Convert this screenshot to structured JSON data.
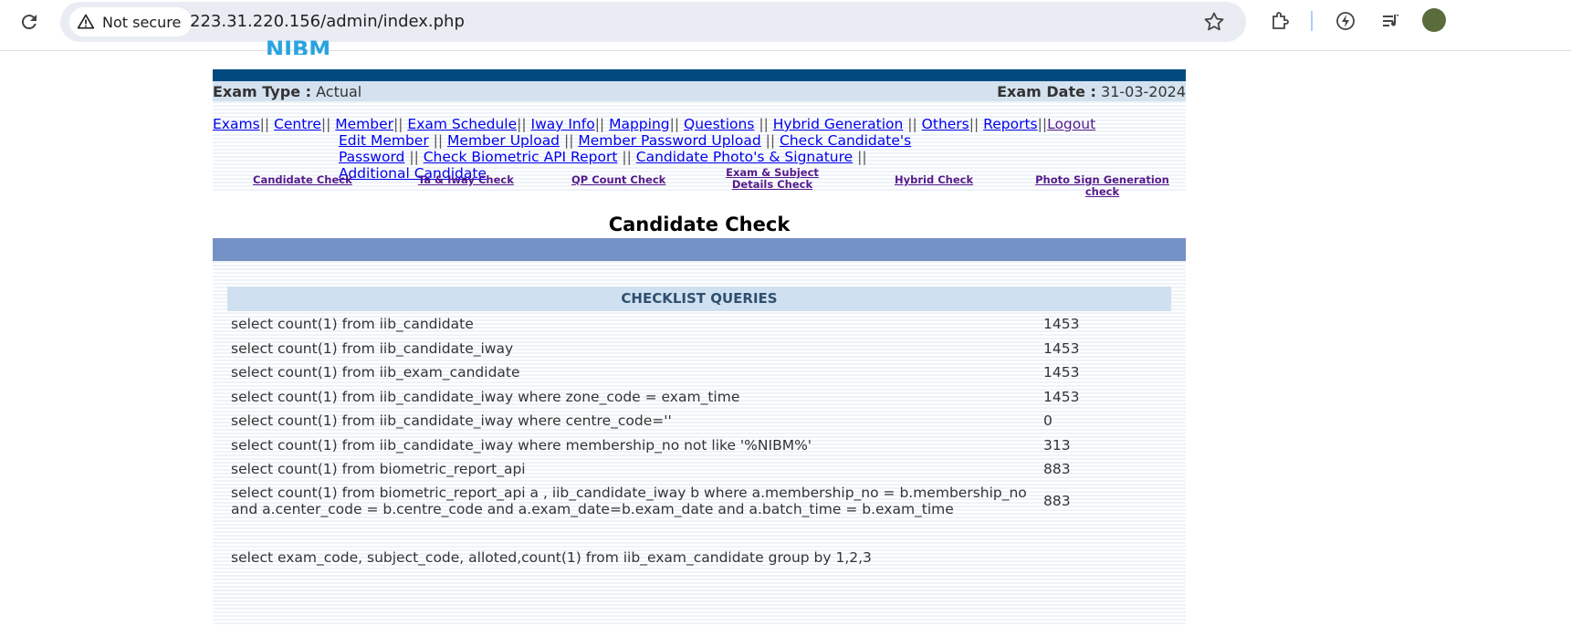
{
  "browser": {
    "security_label": "Not secure",
    "url": "223.31.220.156/admin/index.php"
  },
  "header": {
    "exam_type_label": "Exam Type :",
    "exam_type_value": "Actual",
    "exam_date_label": "Exam Date :",
    "exam_date_value": "31-03-2024"
  },
  "nav": {
    "items": [
      "Exams",
      "Centre",
      "Member",
      "Exam Schedule",
      "Iway Info",
      "Mapping",
      "Questions",
      "Hybrid Generation",
      "Others",
      "Reports",
      "Logout"
    ],
    "sep": "||"
  },
  "submenu": {
    "items": [
      "Edit Member",
      "Member Upload",
      "Member Password Upload",
      "Check Candidate's Password",
      "Check Biometric API Report",
      "Candidate Photo's & Signature",
      "Additional Candidate"
    ]
  },
  "quick_links": [
    "Candidate Check",
    "Ta & Iway Check",
    "QP Count Check",
    "Exam & Subject Details Check",
    "Hybrid Check",
    "Photo Sign Generation check"
  ],
  "page_title": "Candidate Check",
  "checklist": {
    "header": "CHECKLIST QUERIES",
    "rows": [
      {
        "query": "select count(1) from iib_candidate",
        "count": "1453"
      },
      {
        "query": "select count(1) from iib_candidate_iway",
        "count": "1453"
      },
      {
        "query": "select count(1) from iib_exam_candidate",
        "count": "1453"
      },
      {
        "query": "select count(1) from iib_candidate_iway where zone_code = exam_time",
        "count": "1453"
      },
      {
        "query": "select count(1) from iib_candidate_iway where centre_code=''",
        "count": "0"
      },
      {
        "query": "select count(1) from iib_candidate_iway where membership_no not like '%NIBM%'",
        "count": "313"
      },
      {
        "query": "select count(1) from biometric_report_api",
        "count": "883"
      },
      {
        "query": "select count(1) from biometric_report_api a , iib_candidate_iway b where a.membership_no = b.membership_no and a.center_code = b.centre_code and a.exam_date=b.exam_date and a.batch_time = b.exam_time",
        "count": "883"
      }
    ],
    "group_query": "select exam_code, subject_code, alloted,count(1) from iib_exam_candidate group by 1,2,3"
  }
}
